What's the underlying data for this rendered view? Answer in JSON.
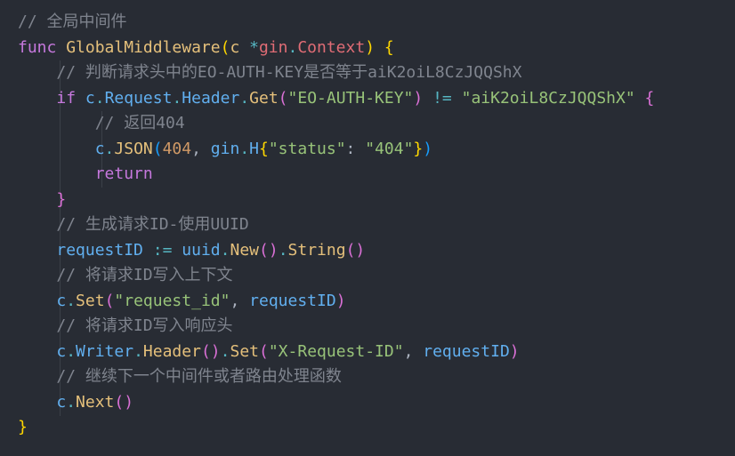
{
  "editor": {
    "language": "go",
    "theme_bg": "#282c34",
    "lines": [
      [
        {
          "t": "// 全局中间件",
          "c": "comment"
        }
      ],
      [
        {
          "t": "func",
          "c": "kw"
        },
        {
          "t": " "
        },
        {
          "t": "GlobalMiddleware",
          "c": "fn"
        },
        {
          "t": "(",
          "c": "yellow"
        },
        {
          "t": "c",
          "c": "fn"
        },
        {
          "t": " "
        },
        {
          "t": "*",
          "c": "op"
        },
        {
          "t": "gin",
          "c": "var"
        },
        {
          "t": ".",
          "c": "op"
        },
        {
          "t": "Context",
          "c": "var"
        },
        {
          "t": ")",
          "c": "yellow"
        },
        {
          "t": " "
        },
        {
          "t": "{",
          "c": "yellow"
        }
      ],
      [
        {
          "t": "    "
        },
        {
          "t": "// 判断请求头中的EO-AUTH-KEY是否等于aiK2oiL8CzJQQShX",
          "c": "comment"
        }
      ],
      [
        {
          "t": "    "
        },
        {
          "t": "if",
          "c": "kw"
        },
        {
          "t": " "
        },
        {
          "t": "c",
          "c": "ident"
        },
        {
          "t": ".",
          "c": "op"
        },
        {
          "t": "Request",
          "c": "ident"
        },
        {
          "t": ".",
          "c": "op"
        },
        {
          "t": "Header",
          "c": "ident"
        },
        {
          "t": ".",
          "c": "op"
        },
        {
          "t": "Get",
          "c": "fn"
        },
        {
          "t": "(",
          "c": "pink"
        },
        {
          "t": "\"EO-AUTH-KEY\"",
          "c": "str"
        },
        {
          "t": ")",
          "c": "pink"
        },
        {
          "t": " "
        },
        {
          "t": "!=",
          "c": "op"
        },
        {
          "t": " "
        },
        {
          "t": "\"aiK2oiL8CzJQQShX\"",
          "c": "str"
        },
        {
          "t": " "
        },
        {
          "t": "{",
          "c": "pink"
        }
      ],
      [
        {
          "t": "        "
        },
        {
          "t": "// 返回404",
          "c": "comment"
        }
      ],
      [
        {
          "t": "        "
        },
        {
          "t": "c",
          "c": "ident"
        },
        {
          "t": ".",
          "c": "op"
        },
        {
          "t": "JSON",
          "c": "fn"
        },
        {
          "t": "(",
          "c": "blue"
        },
        {
          "t": "404",
          "c": "num"
        },
        {
          "t": ", "
        },
        {
          "t": "gin",
          "c": "ident"
        },
        {
          "t": ".",
          "c": "op"
        },
        {
          "t": "H",
          "c": "ident"
        },
        {
          "t": "{",
          "c": "yellow"
        },
        {
          "t": "\"status\"",
          "c": "str"
        },
        {
          "t": ": "
        },
        {
          "t": "\"404\"",
          "c": "str"
        },
        {
          "t": "}",
          "c": "yellow"
        },
        {
          "t": ")",
          "c": "blue"
        }
      ],
      [
        {
          "t": "        "
        },
        {
          "t": "return",
          "c": "kw"
        }
      ],
      [
        {
          "t": "    "
        },
        {
          "t": "}",
          "c": "pink"
        }
      ],
      [
        {
          "t": "    "
        },
        {
          "t": "// 生成请求ID-使用UUID",
          "c": "comment"
        }
      ],
      [
        {
          "t": "    "
        },
        {
          "t": "requestID",
          "c": "ident"
        },
        {
          "t": " "
        },
        {
          "t": ":=",
          "c": "op"
        },
        {
          "t": " "
        },
        {
          "t": "uuid",
          "c": "ident"
        },
        {
          "t": ".",
          "c": "op"
        },
        {
          "t": "New",
          "c": "fn"
        },
        {
          "t": "()",
          "c": "pink"
        },
        {
          "t": ".",
          "c": "op"
        },
        {
          "t": "String",
          "c": "fn"
        },
        {
          "t": "()",
          "c": "pink"
        }
      ],
      [
        {
          "t": "    "
        },
        {
          "t": "// 将请求ID写入上下文",
          "c": "comment"
        }
      ],
      [
        {
          "t": "    "
        },
        {
          "t": "c",
          "c": "ident"
        },
        {
          "t": ".",
          "c": "op"
        },
        {
          "t": "Set",
          "c": "fn"
        },
        {
          "t": "(",
          "c": "pink"
        },
        {
          "t": "\"request_id\"",
          "c": "str"
        },
        {
          "t": ", "
        },
        {
          "t": "requestID",
          "c": "ident"
        },
        {
          "t": ")",
          "c": "pink"
        }
      ],
      [
        {
          "t": "    "
        },
        {
          "t": "// 将请求ID写入响应头",
          "c": "comment"
        }
      ],
      [
        {
          "t": "    "
        },
        {
          "t": "c",
          "c": "ident"
        },
        {
          "t": ".",
          "c": "op"
        },
        {
          "t": "Writer",
          "c": "ident"
        },
        {
          "t": ".",
          "c": "op"
        },
        {
          "t": "Header",
          "c": "fn"
        },
        {
          "t": "()",
          "c": "pink"
        },
        {
          "t": ".",
          "c": "op"
        },
        {
          "t": "Set",
          "c": "fn"
        },
        {
          "t": "(",
          "c": "pink"
        },
        {
          "t": "\"X-Request-ID\"",
          "c": "str"
        },
        {
          "t": ", "
        },
        {
          "t": "requestID",
          "c": "ident"
        },
        {
          "t": ")",
          "c": "pink"
        }
      ],
      [
        {
          "t": "    "
        },
        {
          "t": "// 继续下一个中间件或者路由处理函数",
          "c": "comment"
        }
      ],
      [
        {
          "t": "    "
        },
        {
          "t": "c",
          "c": "ident"
        },
        {
          "t": ".",
          "c": "op"
        },
        {
          "t": "Next",
          "c": "fn"
        },
        {
          "t": "()",
          "c": "pink"
        }
      ],
      [
        {
          "t": "}",
          "c": "yellow"
        }
      ]
    ]
  }
}
